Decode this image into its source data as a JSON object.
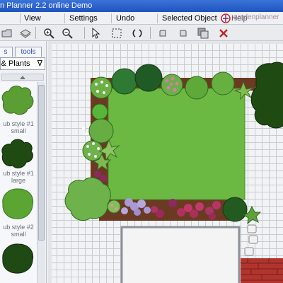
{
  "app": {
    "title": "n Planner 2.2 online Demo",
    "logo_text": "gardenplanner"
  },
  "menu": {
    "view": "View",
    "settings": "Settings",
    "undo": "Undo",
    "selected_object": "Selected Object",
    "help": "Help"
  },
  "toolbar": {
    "icons": [
      "open-icon",
      "save-icon",
      "zoom-in-icon",
      "zoom-out-icon",
      "select-arrow-icon",
      "marquee-select-icon",
      "rotate-icon",
      "undo-icon",
      "redo-icon",
      "layer-icon",
      "delete-icon"
    ]
  },
  "tabs": {
    "plants": "s",
    "tools": "tools"
  },
  "category": {
    "selected": "s & Plants"
  },
  "plants": [
    {
      "label": "ub style #1",
      "size": "small",
      "color": "#5a9e34"
    },
    {
      "label": "ub style #1",
      "size": "large",
      "color": "#1f4a12"
    },
    {
      "label": "ub style #2",
      "size": "small",
      "color": "#5ba532"
    },
    {
      "label": "",
      "size": "",
      "color": "#1f4a14"
    }
  ],
  "colors": {
    "title_bar": "#2a5fcc",
    "lawn": "#6bb843",
    "border_soil": "#6b3a22",
    "delete_red": "#c0281e"
  }
}
